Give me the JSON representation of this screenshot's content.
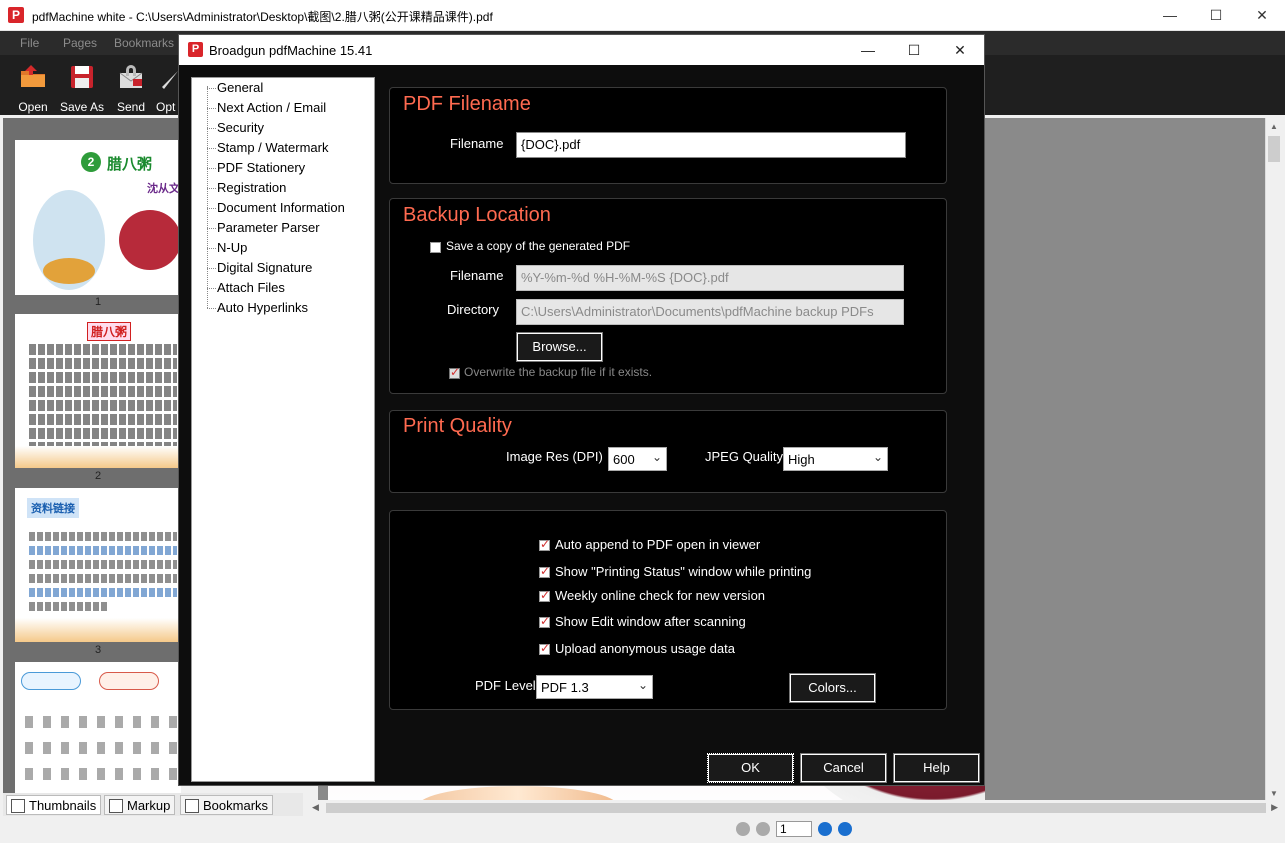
{
  "window": {
    "title": "pdfMachine white - C:\\Users\\Administrator\\Desktop\\截图\\2.腊八粥(公开课精品课件).pdf"
  },
  "menu": [
    "File",
    "Pages",
    "Bookmarks"
  ],
  "toolbar": [
    {
      "label": "Open",
      "icon": "folder-icon"
    },
    {
      "label": "Save As",
      "icon": "floppy-icon"
    },
    {
      "label": "Send",
      "icon": "mail-icon"
    },
    {
      "label": "Opt",
      "icon": "options-icon"
    }
  ],
  "thumbnails": {
    "pages": [
      {
        "number": "1",
        "heading": "腊八粥",
        "author": "沈从文"
      },
      {
        "number": "2",
        "heading": "腊八粥"
      },
      {
        "number": "3",
        "heading": "资料链接"
      }
    ]
  },
  "bottom_tabs": [
    "Thumbnails",
    "Markup",
    "Bookmarks"
  ],
  "document": {
    "visible_text": "从文"
  },
  "navigation": {
    "page": "1"
  },
  "dialog": {
    "title": "Broadgun pdfMachine 15.41",
    "nav_items": [
      "General",
      "Next Action / Email",
      "Security",
      "Stamp / Watermark",
      "PDF Stationery",
      "Registration",
      "Document Information",
      "Parameter Parser",
      "N-Up",
      "Digital Signature",
      "Attach Files",
      "Auto Hyperlinks"
    ],
    "pdf_filename": {
      "title": "PDF Filename",
      "filename_label": "Filename",
      "filename_value": "{DOC}.pdf"
    },
    "backup": {
      "title": "Backup Location",
      "save_copy_label": "Save a copy of the generated PDF",
      "save_copy_checked": false,
      "filename_label": "Filename",
      "filename_value": "%Y-%m-%d %H-%M-%S {DOC}.pdf",
      "directory_label": "Directory",
      "directory_value": "C:\\Users\\Administrator\\Documents\\pdfMachine backup PDFs",
      "browse_label": "Browse...",
      "overwrite_label": "Overwrite the backup file if it exists.",
      "overwrite_checked": true
    },
    "print_quality": {
      "title": "Print Quality",
      "image_res_label": "Image Res (DPI)",
      "image_res_value": "600",
      "jpeg_label": "JPEG Quality",
      "jpeg_value": "High"
    },
    "options": [
      {
        "label": "Auto append to PDF open in viewer",
        "checked": true
      },
      {
        "label": "Show \"Printing Status\" window while printing",
        "checked": true
      },
      {
        "label": "Weekly online check for new version",
        "checked": true
      },
      {
        "label": "Show Edit window after scanning",
        "checked": true
      },
      {
        "label": "Upload anonymous usage data",
        "checked": true
      }
    ],
    "pdf_level_label": "PDF Level",
    "pdf_level_value": "PDF 1.3",
    "colors_label": "Colors...",
    "ok_label": "OK",
    "cancel_label": "Cancel",
    "help_label": "Help"
  },
  "colors": {
    "accent": "#ff6a50",
    "app_red": "#d9252a"
  }
}
